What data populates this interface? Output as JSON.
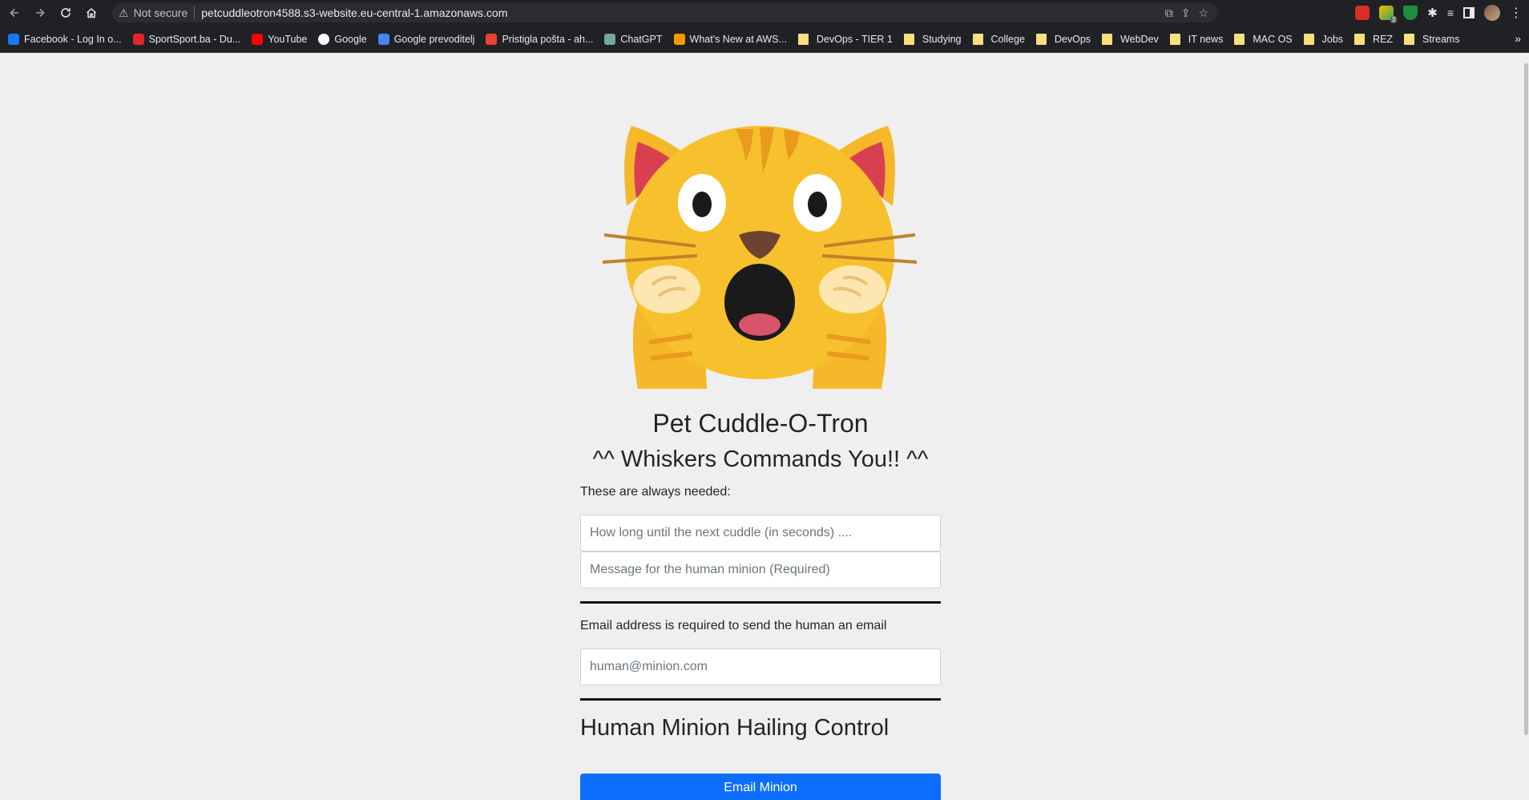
{
  "browser": {
    "security_label": "Not secure",
    "url": "petcuddleotron4588.s3-website.eu-central-1.amazonaws.com",
    "bookmarks": [
      {
        "label": "Facebook - Log In o...",
        "icon": "facebook-icon",
        "color": "#1877f2"
      },
      {
        "label": "SportSport.ba - Du...",
        "icon": "sportsport-icon",
        "color": "#e4262c"
      },
      {
        "label": "YouTube",
        "icon": "youtube-icon",
        "color": "#ff0000"
      },
      {
        "label": "Google",
        "icon": "google-icon",
        "color": "#ffffff"
      },
      {
        "label": "Google prevoditelj",
        "icon": "translate-icon",
        "color": "#4285f4"
      },
      {
        "label": "Pristigla pošta - ah...",
        "icon": "gmail-icon",
        "color": "#ea4335"
      },
      {
        "label": "ChatGPT",
        "icon": "chatgpt-icon",
        "color": "#74aa9c"
      },
      {
        "label": "What's New at AWS...",
        "icon": "aws-icon",
        "color": "#ff9900"
      },
      {
        "label": "DevOps - TIER 1",
        "icon": "folder-icon"
      },
      {
        "label": "Studying",
        "icon": "folder-icon"
      },
      {
        "label": "College",
        "icon": "folder-icon"
      },
      {
        "label": "DevOps",
        "icon": "folder-icon"
      },
      {
        "label": "WebDev",
        "icon": "folder-icon"
      },
      {
        "label": "IT news",
        "icon": "folder-icon"
      },
      {
        "label": "MAC OS",
        "icon": "folder-icon"
      },
      {
        "label": "Jobs",
        "icon": "folder-icon"
      },
      {
        "label": "REZ",
        "icon": "folder-icon"
      },
      {
        "label": "Streams",
        "icon": "folder-icon"
      }
    ],
    "extension_badge": "3"
  },
  "page": {
    "title": "Pet Cuddle-O-Tron",
    "subtitle": "^^ Whiskers Commands You!! ^^",
    "always_needed_label": "These are always needed:",
    "delay_placeholder": "How long until the next cuddle (in seconds) ....",
    "message_placeholder": "Message for the human minion (Required)",
    "email_label": "Email address is required to send the human an email",
    "email_placeholder": "human@minion.com",
    "control_heading": "Human Minion Hailing Control",
    "email_button": "Email Minion"
  },
  "colors": {
    "primary_button": "#0d6efd",
    "page_bg": "#efefef"
  }
}
